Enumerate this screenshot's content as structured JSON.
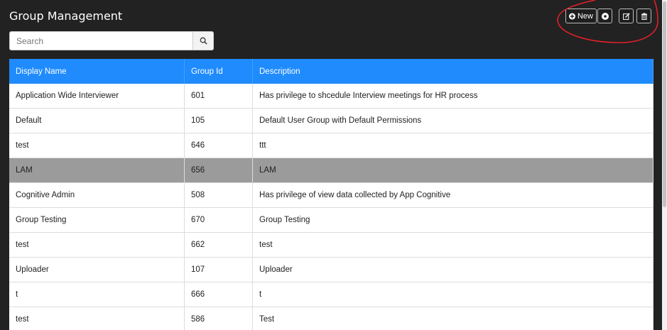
{
  "header": {
    "title": "Group Management"
  },
  "search": {
    "placeholder": "Search",
    "value": ""
  },
  "toolbar": {
    "new_label": "New",
    "icons": [
      "plus-circle-icon",
      "settings-icon",
      "edit-icon",
      "trash-icon"
    ]
  },
  "table": {
    "columns": [
      "Display Name",
      "Group Id",
      "Description"
    ],
    "rows": [
      {
        "name": "Application Wide Interviewer",
        "id": "601",
        "description": "Has privilege to shcedule Interview meetings for HR process"
      },
      {
        "name": "Default",
        "id": "105",
        "description": "Default User Group with Default Permissions"
      },
      {
        "name": "test",
        "id": "646",
        "description": "ttt"
      },
      {
        "name": "LAM",
        "id": "656",
        "description": "LAM"
      },
      {
        "name": "Cognitive Admin",
        "id": "508",
        "description": "Has privilege of view data collected by App Cognitive"
      },
      {
        "name": "Group Testing",
        "id": "670",
        "description": "Group Testing"
      },
      {
        "name": "test",
        "id": "662",
        "description": "test"
      },
      {
        "name": "Uploader",
        "id": "107",
        "description": "Uploader"
      },
      {
        "name": "t",
        "id": "666",
        "description": "t"
      },
      {
        "name": "test",
        "id": "586",
        "description": "Test"
      }
    ],
    "selected_row": 3
  },
  "colors": {
    "panel_bg": "#222222",
    "header_row": "#1f8bfd",
    "selected_row": "#9b9b9b",
    "annotation": "#e8202a"
  }
}
